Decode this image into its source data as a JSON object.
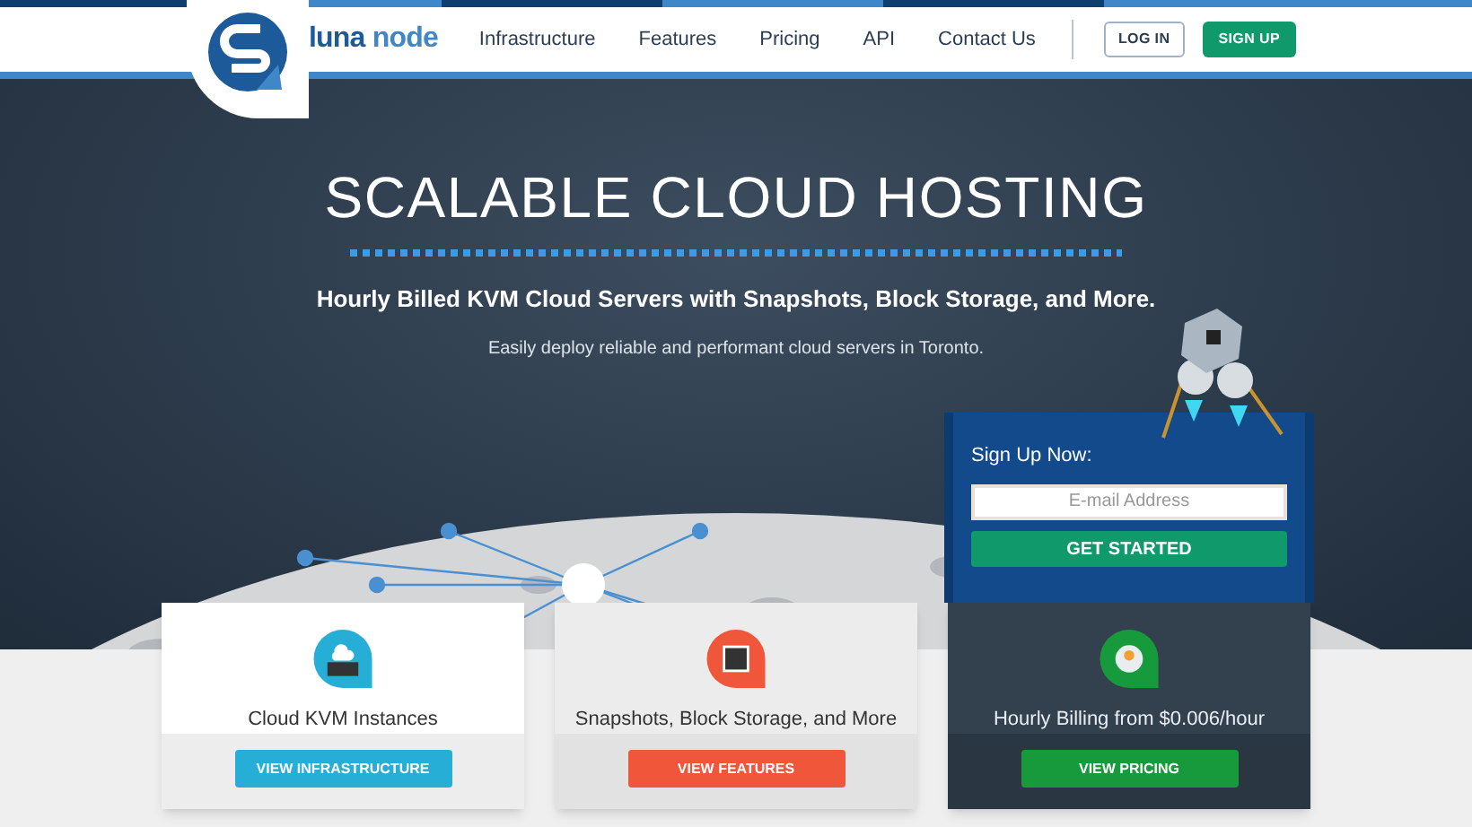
{
  "logo": {
    "part_1": "luna",
    "part_2": "node"
  },
  "nav": {
    "links": [
      "Infrastructure",
      "Features",
      "Pricing",
      "API",
      "Contact Us"
    ],
    "login": "LOG IN",
    "signup": "SIGN UP"
  },
  "hero": {
    "title": "SCALABLE CLOUD HOSTING",
    "subtitle": "Hourly Billed KVM Cloud Servers with Snapshots, Block Storage, and More.",
    "tagline": "Easily deploy reliable and performant cloud servers in Toronto."
  },
  "signup_box": {
    "label": "Sign Up Now:",
    "email_placeholder": "E-mail Address",
    "button": "GET STARTED"
  },
  "cards": [
    {
      "kind": "light",
      "title": "Cloud KVM Instances",
      "button": "VIEW INFRASTRUCTURE",
      "color": "#27aed6"
    },
    {
      "kind": "gray",
      "title": "Snapshots, Block Storage, and More",
      "button": "VIEW FEATURES",
      "color": "#f0563a"
    },
    {
      "kind": "dark",
      "title": "Hourly Billing from $0.006/hour",
      "button": "VIEW PRICING",
      "color": "#179a3c"
    }
  ]
}
